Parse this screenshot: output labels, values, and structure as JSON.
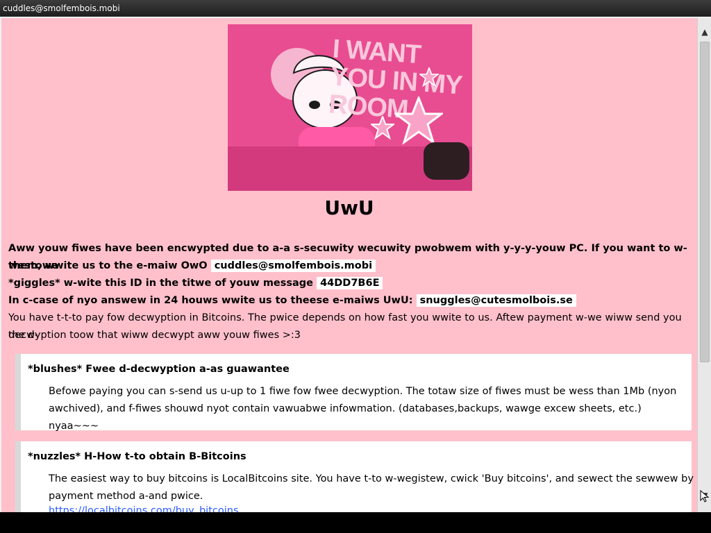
{
  "window": {
    "title": "cuddles@smolfembois.mobi"
  },
  "hero": {
    "text": "I WANT YOU IN MY ROOM"
  },
  "page": {
    "title": "UwU",
    "line1": "Aww youw fiwes have been encwypted due to a-a s-secuwity wecuwity pwobwem with y-y-y-youw PC. If you want to w-westowe",
    "line2_pre": "them, wwite us to the e-maiw OwO",
    "email_primary": "cuddles@smolfembois.mobi",
    "line3_pre": "*giggles* w-wite this ID in the titwe of youw message",
    "id_value": "44DD7B6E",
    "line4_pre": "In c-case of nyo answew in 24 houws wwite us to theese e-maiws UwU:",
    "email_secondary": "snuggles@cutesmolbois.se",
    "line5": "You have t-t-to pay fow decwyption in Bitcoins. The pwice depends on how fast you wwite to us. Aftew payment w-we wiww send you the d-",
    "line6": "decwyption toow that wiww decwypt aww youw fiwes >:3"
  },
  "box1": {
    "title": "*blushes* Fwee d-decwyption a-as guawantee",
    "body": "Befowe paying you can s-send us u-up to 1 fiwe fow fwee decwyption. The totaw size of fiwes must be wess than 1Mb (nyon awchived), and f-fiwes shouwd nyot contain vawuabwe infowmation. (databases,backups, wawge excew sheets, etc.) nyaa~~~"
  },
  "box2": {
    "title": "*nuzzles* H-How t-to obtain B-Bitcoins",
    "body": "The easiest way to buy bitcoins is LocalBitcoins site. You have t-to w-wegistew, cwick 'Buy bitcoins', and sewect the sewwew by payment method a-and pwice.",
    "link": "https://localbitcoins.com/buy_bitcoins"
  },
  "icons": {
    "up": "scroll-up-arrow-icon",
    "down": "scroll-down-arrow-icon",
    "cursor": "mouse-cursor-icon"
  }
}
